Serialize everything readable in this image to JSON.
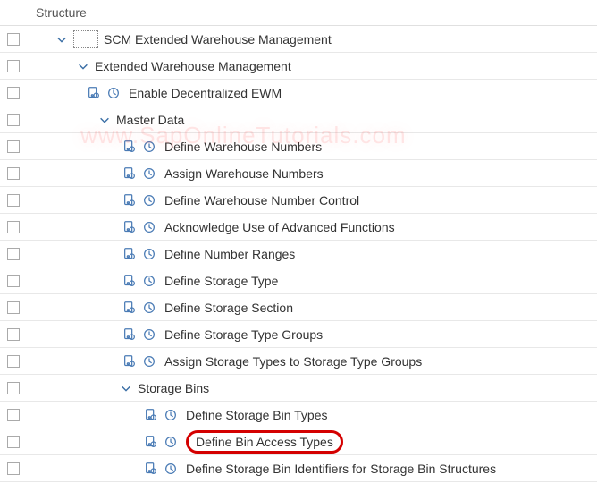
{
  "header": "Structure",
  "watermark": "www.SapOnlineTutorials.com",
  "tree": [
    {
      "indent": 28,
      "chevron": true,
      "focusbox": true,
      "icons": false,
      "label": "SCM Extended Warehouse Management",
      "name": "node-scm-ewm",
      "highlight": false
    },
    {
      "indent": 52,
      "chevron": true,
      "focusbox": false,
      "icons": false,
      "label": "Extended Warehouse Management",
      "name": "node-ewm",
      "highlight": false
    },
    {
      "indent": 64,
      "chevron": false,
      "focusbox": false,
      "icons": true,
      "label": "Enable Decentralized EWM",
      "name": "node-enable-decentralized-ewm",
      "highlight": false
    },
    {
      "indent": 76,
      "chevron": true,
      "focusbox": false,
      "icons": false,
      "label": "Master Data",
      "name": "node-master-data",
      "highlight": false
    },
    {
      "indent": 104,
      "chevron": false,
      "focusbox": false,
      "icons": true,
      "label": "Define Warehouse Numbers",
      "name": "node-define-warehouse-numbers",
      "highlight": false
    },
    {
      "indent": 104,
      "chevron": false,
      "focusbox": false,
      "icons": true,
      "label": "Assign Warehouse Numbers",
      "name": "node-assign-warehouse-numbers",
      "highlight": false
    },
    {
      "indent": 104,
      "chevron": false,
      "focusbox": false,
      "icons": true,
      "label": "Define Warehouse Number Control",
      "name": "node-define-warehouse-number-control",
      "highlight": false
    },
    {
      "indent": 104,
      "chevron": false,
      "focusbox": false,
      "icons": true,
      "label": "Acknowledge Use of Advanced Functions",
      "name": "node-acknowledge-advanced-functions",
      "highlight": false
    },
    {
      "indent": 104,
      "chevron": false,
      "focusbox": false,
      "icons": true,
      "label": "Define Number Ranges",
      "name": "node-define-number-ranges",
      "highlight": false
    },
    {
      "indent": 104,
      "chevron": false,
      "focusbox": false,
      "icons": true,
      "label": "Define Storage Type",
      "name": "node-define-storage-type",
      "highlight": false
    },
    {
      "indent": 104,
      "chevron": false,
      "focusbox": false,
      "icons": true,
      "label": "Define Storage Section",
      "name": "node-define-storage-section",
      "highlight": false
    },
    {
      "indent": 104,
      "chevron": false,
      "focusbox": false,
      "icons": true,
      "label": "Define Storage Type Groups",
      "name": "node-define-storage-type-groups",
      "highlight": false
    },
    {
      "indent": 104,
      "chevron": false,
      "focusbox": false,
      "icons": true,
      "label": "Assign Storage Types to Storage Type Groups",
      "name": "node-assign-storage-types-to-groups",
      "highlight": false
    },
    {
      "indent": 100,
      "chevron": true,
      "focusbox": false,
      "icons": false,
      "label": "Storage Bins",
      "name": "node-storage-bins",
      "highlight": false
    },
    {
      "indent": 128,
      "chevron": false,
      "focusbox": false,
      "icons": true,
      "label": "Define Storage Bin Types",
      "name": "node-define-storage-bin-types",
      "highlight": false
    },
    {
      "indent": 128,
      "chevron": false,
      "focusbox": false,
      "icons": true,
      "label": "Define Bin Access Types",
      "name": "node-define-bin-access-types",
      "highlight": true
    },
    {
      "indent": 128,
      "chevron": false,
      "focusbox": false,
      "icons": true,
      "label": "Define Storage Bin Identifiers for Storage Bin Structures",
      "name": "node-define-storage-bin-identifiers",
      "highlight": false
    }
  ]
}
